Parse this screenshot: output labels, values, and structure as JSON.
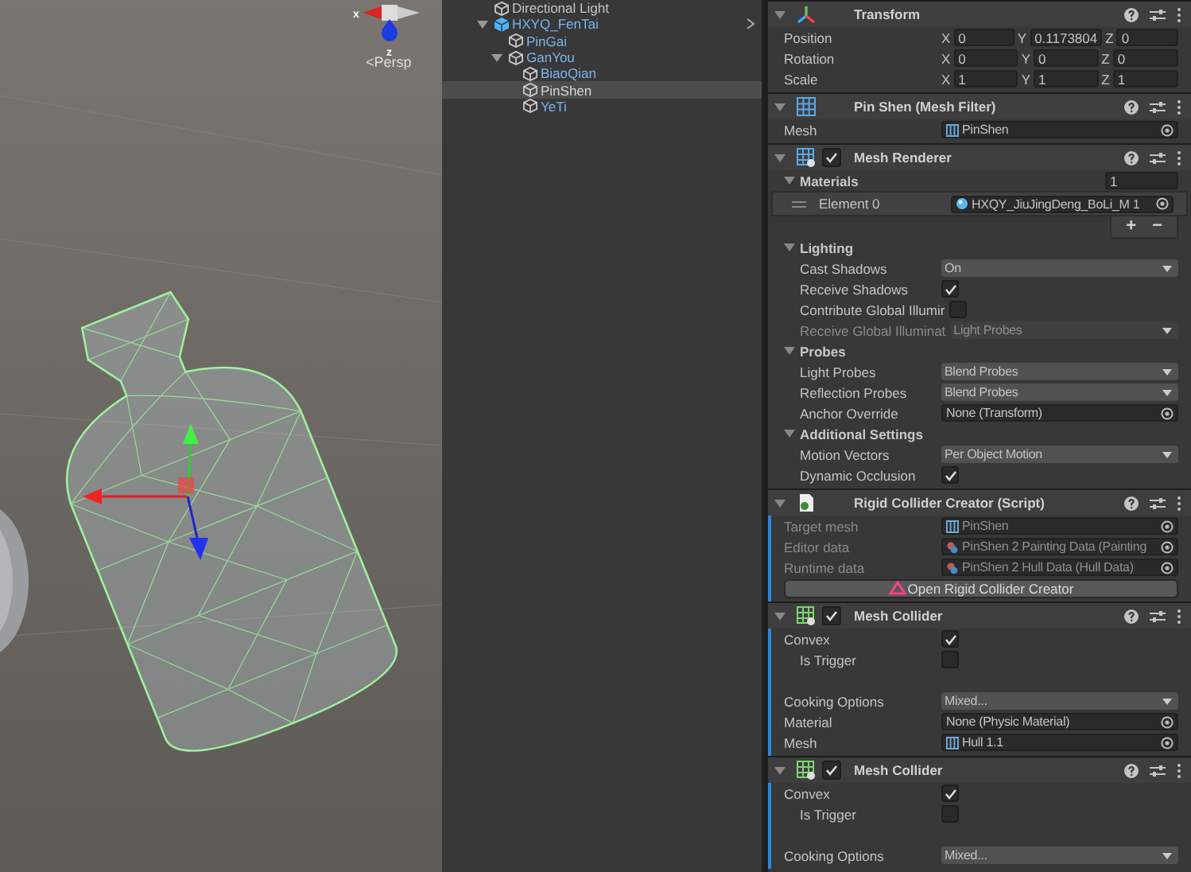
{
  "scene": {
    "axis_labels": [
      "x",
      "z"
    ],
    "projection": "<Persp"
  },
  "hierarchy": {
    "items": [
      {
        "name": "Directional Light",
        "kind": "object",
        "selected": false
      },
      {
        "name": "HXYQ_FenTai",
        "kind": "prefab-root",
        "selected": false,
        "expanded": true,
        "children": [
          {
            "name": "PinGai",
            "kind": "prefab-child",
            "selected": false
          },
          {
            "name": "GanYou",
            "kind": "prefab-child",
            "selected": false,
            "expanded": true,
            "children": [
              {
                "name": "BiaoQian",
                "kind": "prefab-child",
                "selected": false
              },
              {
                "name": "PinShen",
                "kind": "prefab-child",
                "selected": true
              },
              {
                "name": "YeTi",
                "kind": "prefab-child",
                "selected": false
              }
            ]
          }
        ]
      }
    ]
  },
  "inspector": {
    "components": [
      {
        "kind": "transform",
        "title": "Transform",
        "expanded": true,
        "added": false,
        "rows": [
          {
            "kind": "vector3",
            "label": "Position",
            "fields": [
              {
                "axis": "X",
                "value": "0"
              },
              {
                "axis": "Y",
                "value": "0.1173804"
              },
              {
                "axis": "Z",
                "value": "0"
              }
            ]
          },
          {
            "kind": "vector3",
            "label": "Rotation",
            "fields": [
              {
                "axis": "X",
                "value": "0"
              },
              {
                "axis": "Y",
                "value": "0"
              },
              {
                "axis": "Z",
                "value": "0"
              }
            ]
          },
          {
            "kind": "vector3",
            "label": "Scale",
            "fields": [
              {
                "axis": "X",
                "value": "1"
              },
              {
                "axis": "Y",
                "value": "1"
              },
              {
                "axis": "Z",
                "value": "1"
              }
            ]
          }
        ]
      },
      {
        "kind": "mesh-filter",
        "title": "Pin Shen (Mesh Filter)",
        "expanded": true,
        "added": false,
        "rows": [
          {
            "kind": "mesh-ref",
            "label": "Mesh",
            "value": "PinShen",
            "disabled": false
          }
        ]
      },
      {
        "kind": "mesh-renderer",
        "title": "Mesh Renderer",
        "enabled": true,
        "expanded": true,
        "added": false,
        "rows": [
          {
            "kind": "array",
            "label": "Materials",
            "count": "1",
            "expanded": true,
            "buttons": [
              "+",
              "−"
            ],
            "children": [
              {
                "kind": "element",
                "label": "Element 0",
                "value": "HXQY_JiuJingDeng_BoLi_M 1"
              }
            ]
          },
          {
            "kind": "section",
            "label": "Lighting",
            "expanded": true,
            "children": [
              {
                "kind": "dropdown",
                "label": "Cast Shadows",
                "value": "On",
                "disabled": false
              },
              {
                "kind": "checkbox",
                "label": "Receive Shadows",
                "checked": true,
                "disabled": false
              },
              {
                "kind": "checkbox",
                "label": "Contribute Global Illumir",
                "checked": false,
                "disabled": false
              },
              {
                "kind": "dropdown",
                "label": "Receive Global Illuminat",
                "value": "Light Probes",
                "disabled": true
              }
            ]
          },
          {
            "kind": "section",
            "label": "Probes",
            "expanded": true,
            "children": [
              {
                "kind": "dropdown",
                "label": "Light Probes",
                "value": "Blend Probes",
                "disabled": false
              },
              {
                "kind": "dropdown",
                "label": "Reflection Probes",
                "value": "Blend Probes",
                "disabled": false
              },
              {
                "kind": "object-ref",
                "label": "Anchor Override",
                "value": "None (Transform)",
                "disabled": false
              }
            ]
          },
          {
            "kind": "section",
            "label": "Additional Settings",
            "expanded": true,
            "children": [
              {
                "kind": "dropdown",
                "label": "Motion Vectors",
                "value": "Per Object Motion",
                "disabled": false
              },
              {
                "kind": "checkbox",
                "label": "Dynamic Occlusion",
                "checked": true,
                "disabled": false
              }
            ]
          }
        ]
      },
      {
        "kind": "script",
        "title": "Rigid Collider Creator (Script)",
        "expanded": true,
        "added": true,
        "rows": [
          {
            "kind": "mesh-ref",
            "label": "Target mesh",
            "value": "PinShen",
            "disabled": true
          },
          {
            "kind": "data-ref",
            "label": "Editor data",
            "value": "PinShen 2 Painting Data (Painting",
            "disabled": true
          },
          {
            "kind": "data-ref",
            "label": "Runtime data",
            "value": "PinShen 2 Hull Data (Hull Data)",
            "disabled": true
          },
          {
            "kind": "button",
            "label": "Open Rigid Collider Creator"
          }
        ]
      },
      {
        "kind": "mesh-collider",
        "title": "Mesh Collider",
        "enabled": true,
        "expanded": true,
        "added": true,
        "rows": [
          {
            "kind": "checkbox",
            "label": "Convex",
            "checked": true,
            "disabled": false,
            "children": [
              {
                "kind": "checkbox",
                "label": "Is Trigger",
                "checked": false,
                "disabled": false
              }
            ]
          },
          {
            "kind": "spacer"
          },
          {
            "kind": "dropdown",
            "label": "Cooking Options",
            "value": "Mixed...",
            "disabled": false
          },
          {
            "kind": "object-ref",
            "label": "Material",
            "value": "None (Physic Material)",
            "disabled": false
          },
          {
            "kind": "mesh-ref",
            "label": "Mesh",
            "value": "Hull 1.1",
            "disabled": false
          }
        ]
      },
      {
        "kind": "mesh-collider",
        "title": "Mesh Collider",
        "enabled": true,
        "expanded": true,
        "added": true,
        "rows": [
          {
            "kind": "checkbox",
            "label": "Convex",
            "checked": true,
            "disabled": false,
            "children": [
              {
                "kind": "checkbox",
                "label": "Is Trigger",
                "checked": false,
                "disabled": false
              }
            ]
          },
          {
            "kind": "spacer"
          },
          {
            "kind": "dropdown",
            "label": "Cooking Options",
            "value": "Mixed...",
            "disabled": false
          }
        ]
      }
    ]
  }
}
